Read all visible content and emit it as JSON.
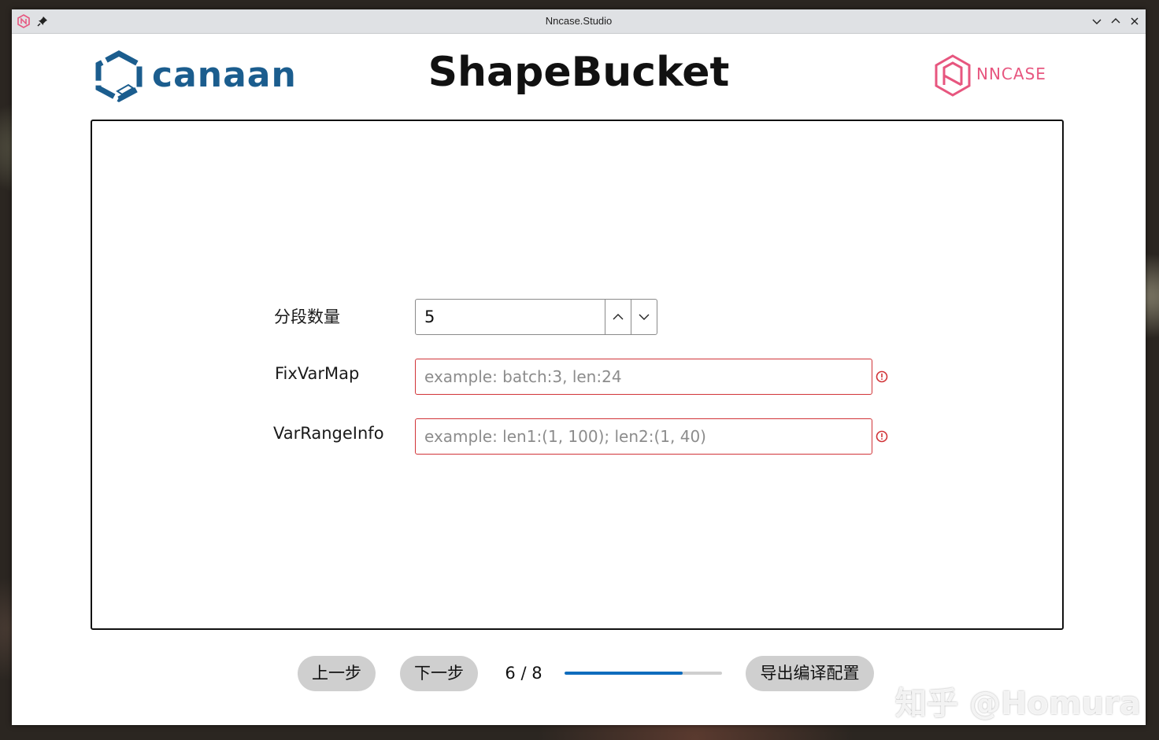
{
  "window": {
    "title": "Nncase.Studio"
  },
  "header": {
    "brand_left": "canaan",
    "title": "ShapeBucket",
    "brand_right": "NNCASE"
  },
  "form": {
    "segment_count": {
      "label": "分段数量",
      "value": "5"
    },
    "fix_var_map": {
      "label": "FixVarMap",
      "value": "",
      "placeholder": "example: batch:3, len:24",
      "error": true
    },
    "var_range_info": {
      "label": "VarRangeInfo",
      "value": "",
      "placeholder": "example: len1:(1, 100); len2:(1, 40)",
      "error": true
    }
  },
  "footer": {
    "prev_label": "上一步",
    "next_label": "下一步",
    "page_indicator": "6 / 8",
    "progress": 0.75,
    "export_label": "导出编译配置"
  },
  "watermark": "知乎 @Homura",
  "colors": {
    "accent": "#0f6cbd",
    "error": "#d13438",
    "canaan_blue": "#1b5d8e",
    "nncase_pink": "#e7567f"
  }
}
